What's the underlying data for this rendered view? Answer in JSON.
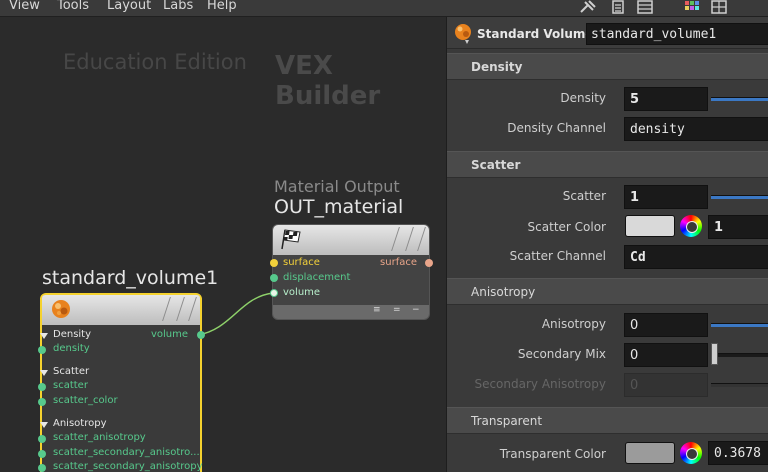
{
  "menubar": {
    "items": [
      "View",
      "Tools",
      "Layout",
      "Labs",
      "Help"
    ]
  },
  "toolbar": {
    "icons": [
      "pin-icon",
      "list-icon",
      "grid-icon",
      "color-palette-icon",
      "layout-icon"
    ]
  },
  "network": {
    "watermark_edition": "Education Edition",
    "watermark_context": "VEX Builder",
    "output_node": {
      "subtitle": "Material Output",
      "name": "OUT_material",
      "inputs": [
        "surface",
        "displacement",
        "volume"
      ],
      "output": "surface"
    },
    "volume_node": {
      "name": "standard_volume1",
      "output": "volume",
      "groups": [
        {
          "label": "Density",
          "ports": [
            "density"
          ]
        },
        {
          "label": "Scatter",
          "ports": [
            "scatter",
            "scatter_color"
          ]
        },
        {
          "label": "Anisotropy",
          "ports": [
            "scatter_anisotropy",
            "scatter_secondary_anisotro...",
            "scatter_secondary_anisotropy"
          ]
        }
      ]
    },
    "colors": {
      "wire": "#8ed16a",
      "selected": "#f5d22e",
      "port_green": "#57c98c",
      "port_yellow": "#f2d13b",
      "port_orange": "#e9a58a"
    }
  },
  "panel": {
    "node_type": "Standard Volume",
    "node_name": "standard_volume1",
    "sections": {
      "density": {
        "title": "Density",
        "density_label": "Density",
        "density_value": "5",
        "density_slider": 0.0,
        "channel_label": "Density Channel",
        "channel_value": "density"
      },
      "scatter": {
        "title": "Scatter",
        "scatter_label": "Scatter",
        "scatter_value": "1",
        "scatter_slider": 0.0,
        "color_label": "Scatter Color",
        "color_value": "1",
        "color_swatch": "#d9d9d9",
        "channel_label": "Scatter Channel",
        "channel_value": "Cd"
      },
      "anisotropy": {
        "title": "Anisotropy",
        "anisotropy_label": "Anisotropy",
        "anisotropy_value": "0",
        "anisotropy_slider": 0.0,
        "mix_label": "Secondary Mix",
        "mix_value": "0",
        "secondary_label": "Secondary Anisotropy",
        "secondary_value": "0"
      },
      "transparent": {
        "title": "Transparent",
        "color_label": "Transparent Color",
        "color_value": "0.3678",
        "color_swatch": "#9b9b9b"
      }
    }
  }
}
